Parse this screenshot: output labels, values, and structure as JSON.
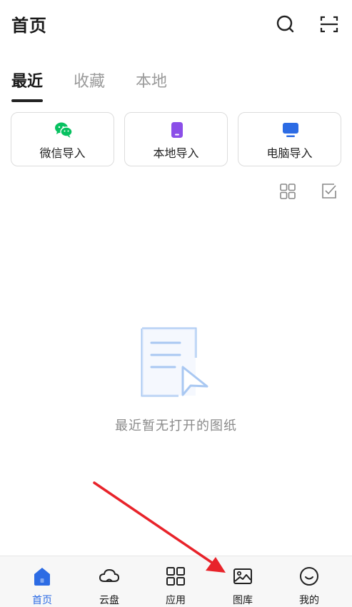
{
  "header": {
    "title": "首页",
    "search_icon": "search-icon",
    "scan_icon": "scan-icon"
  },
  "tabs": [
    {
      "label": "最近",
      "active": true
    },
    {
      "label": "收藏",
      "active": false
    },
    {
      "label": "本地",
      "active": false
    }
  ],
  "import_options": [
    {
      "label": "微信导入",
      "icon": "wechat-icon",
      "color": "#07c160"
    },
    {
      "label": "本地导入",
      "icon": "phone-icon",
      "color": "#8b4ee8"
    },
    {
      "label": "电脑导入",
      "icon": "monitor-icon",
      "color": "#2c6be4"
    }
  ],
  "view_controls": {
    "grid_icon": "grid-view-icon",
    "select_icon": "select-checkbox-icon"
  },
  "empty_state": {
    "message": "最近暂无打开的图纸",
    "icon": "document-cursor-icon"
  },
  "bottom_nav": [
    {
      "label": "首页",
      "icon": "home-icon",
      "active": true
    },
    {
      "label": "云盘",
      "icon": "cloud-icon",
      "active": false
    },
    {
      "label": "应用",
      "icon": "apps-icon",
      "active": false
    },
    {
      "label": "图库",
      "icon": "gallery-icon",
      "active": false
    },
    {
      "label": "我的",
      "icon": "profile-icon",
      "active": false
    }
  ],
  "colors": {
    "accent": "#2c6be4",
    "annotation_arrow": "#e8232a"
  }
}
